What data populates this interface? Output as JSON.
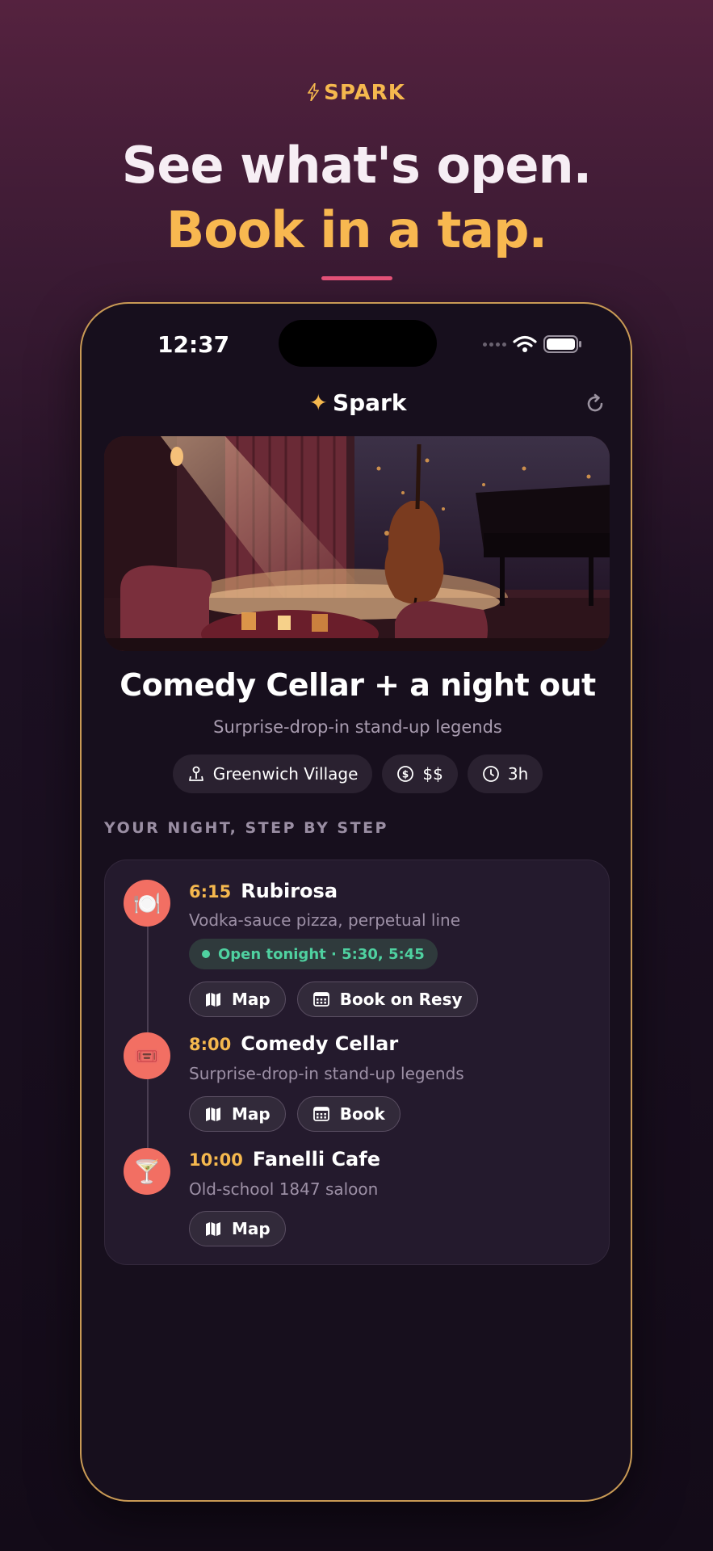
{
  "promo": {
    "brand": "SPARK",
    "headline_line1": "See what's open.",
    "headline_line2": "Book in a tap."
  },
  "status_bar": {
    "time": "12:37"
  },
  "app": {
    "name": "Spark"
  },
  "feature": {
    "title": "Comedy Cellar + a night out",
    "subtitle": "Surprise-drop-in stand-up legends",
    "chips": [
      {
        "icon": "location-pin-icon",
        "label": "Greenwich Village"
      },
      {
        "icon": "dollar-coin-icon",
        "label": "$$"
      },
      {
        "icon": "clock-icon",
        "label": "3h"
      }
    ]
  },
  "itinerary": {
    "section_label": "YOUR NIGHT, STEP BY STEP",
    "stops": [
      {
        "time": "6:15",
        "name": "Rubirosa",
        "desc": "Vodka-sauce pizza, perpetual line",
        "icon": "plate-cutlery-icon",
        "availability": "Open tonight · 5:30, 5:45",
        "actions": [
          "Map",
          "Book on Resy"
        ]
      },
      {
        "time": "8:00",
        "name": "Comedy Cellar",
        "desc": "Surprise-drop-in stand-up legends",
        "icon": "ticket-icon",
        "actions": [
          "Map",
          "Book"
        ]
      },
      {
        "time": "10:00",
        "name": "Fanelli Cafe",
        "desc": "Old-school 1847 saloon",
        "icon": "cocktail-icon",
        "actions": [
          "Map"
        ]
      }
    ]
  },
  "colors": {
    "accent": "#f5b84e",
    "brand_pink": "#e7537a",
    "open_green": "#4fd1a0",
    "stop_icon_bg": "#f26f63"
  }
}
